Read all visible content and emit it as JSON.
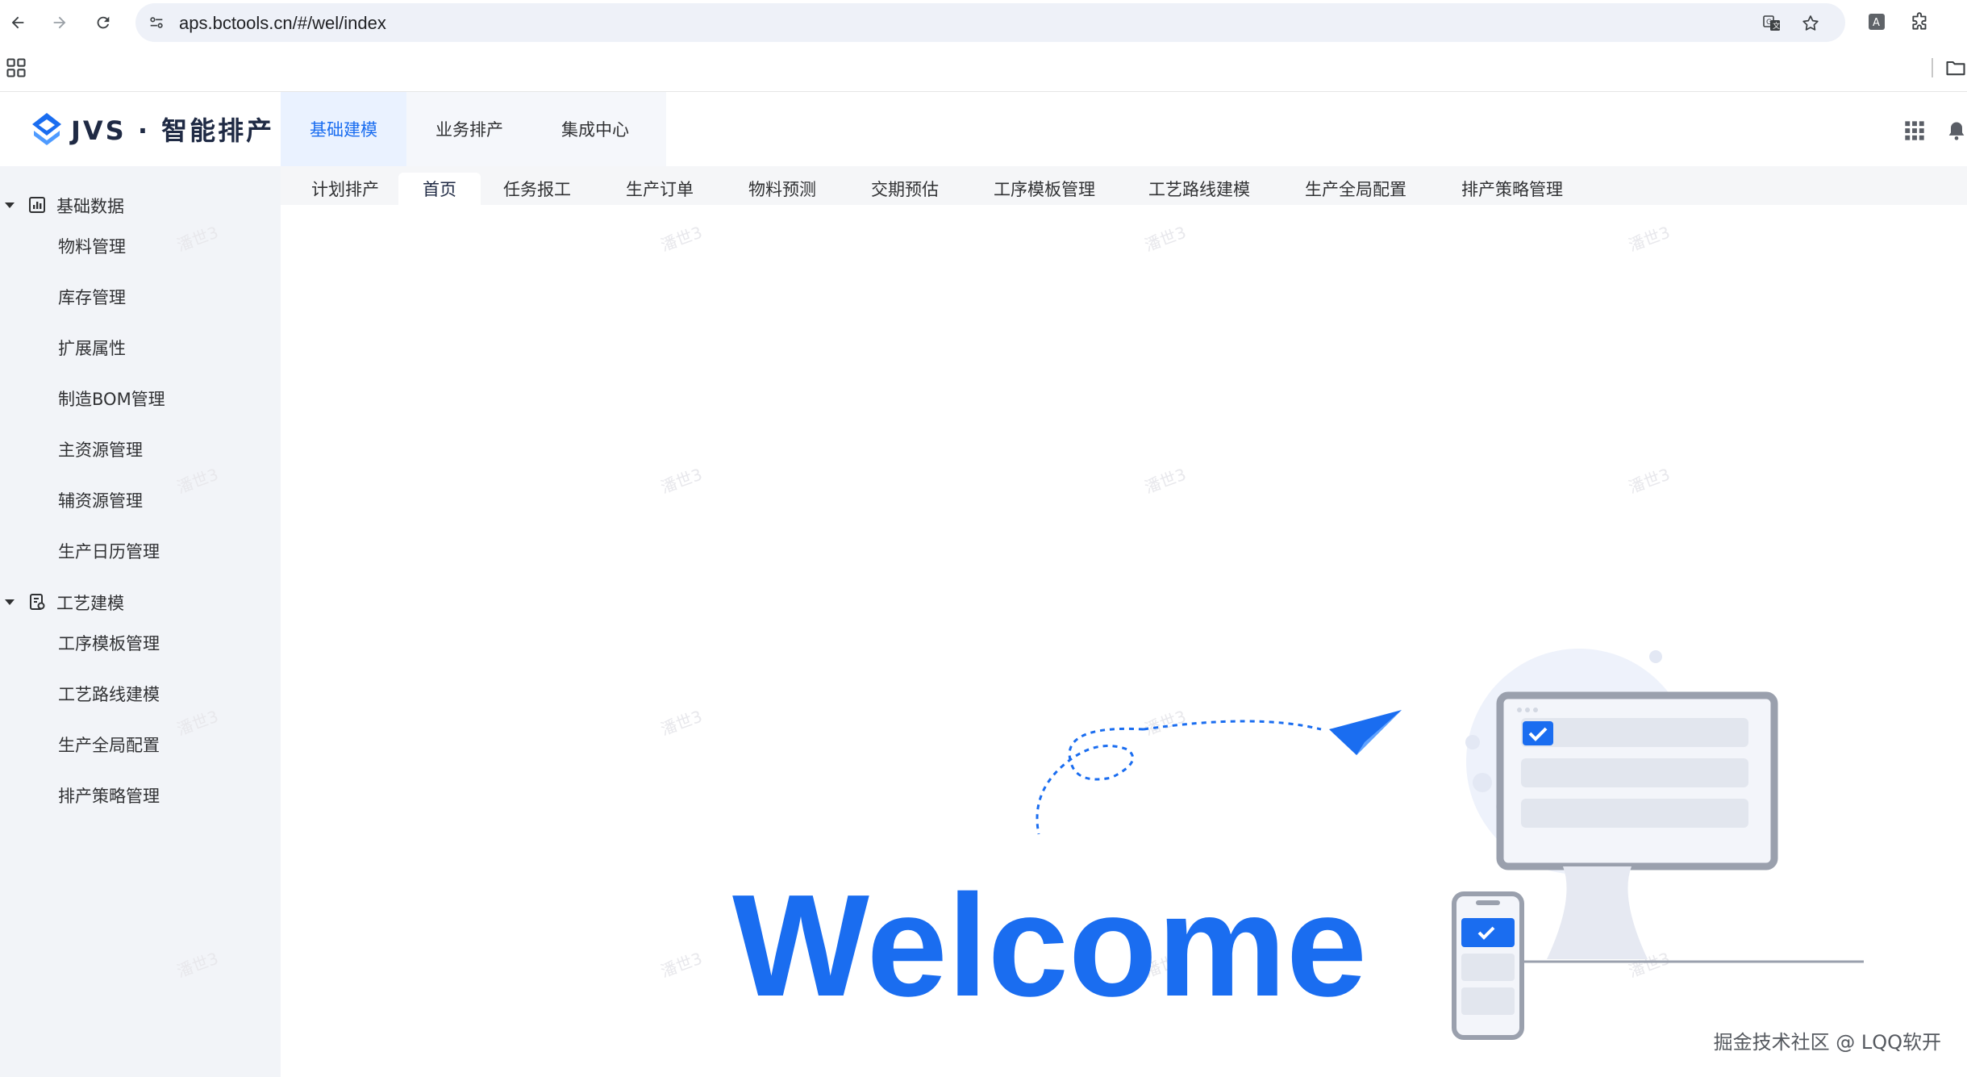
{
  "browser": {
    "url": "aps.bctools.cn/#/wel/index",
    "icons": [
      "back-icon",
      "forward-icon",
      "reload-icon",
      "site-settings-icon",
      "translate-icon",
      "star-icon",
      "profile-icon",
      "extensions-icon",
      "apps-icon",
      "folder-icon"
    ],
    "profile_letter": "A"
  },
  "app": {
    "logo_text": "JVS · 智能排产",
    "top_tabs": [
      {
        "label": "基础建模",
        "active": true
      },
      {
        "label": "业务排产",
        "active": false
      },
      {
        "label": "集成中心",
        "active": false
      }
    ]
  },
  "sidebar": {
    "groups": [
      {
        "label": "基础数据",
        "icon": "chart-icon",
        "items": [
          "物料管理",
          "库存管理",
          "扩展属性",
          "制造BOM管理",
          "主资源管理",
          "辅资源管理",
          "生产日历管理"
        ]
      },
      {
        "label": "工艺建模",
        "icon": "process-icon",
        "items": [
          "工序模板管理",
          "工艺路线建模",
          "生产全局配置",
          "排产策略管理"
        ]
      }
    ]
  },
  "subtabs": [
    {
      "label": "计划排产",
      "active": false
    },
    {
      "label": "首页",
      "active": true
    },
    {
      "label": "任务报工",
      "active": false
    },
    {
      "label": "生产订单",
      "active": false
    },
    {
      "label": "物料预测",
      "active": false
    },
    {
      "label": "交期预估",
      "active": false
    },
    {
      "label": "工序模板管理",
      "active": false
    },
    {
      "label": "工艺路线建模",
      "active": false
    },
    {
      "label": "生产全局配置",
      "active": false
    },
    {
      "label": "排产策略管理",
      "active": false
    }
  ],
  "content": {
    "welcome_text": "Welcome",
    "watermark": "潘世3",
    "footer_credit": "掘金技术社区 @ LQQ软开"
  },
  "colors": {
    "accent": "#1a6df0",
    "sidebar_bg": "#f2f4f8",
    "illustration_gray": "#9aa0ad"
  }
}
